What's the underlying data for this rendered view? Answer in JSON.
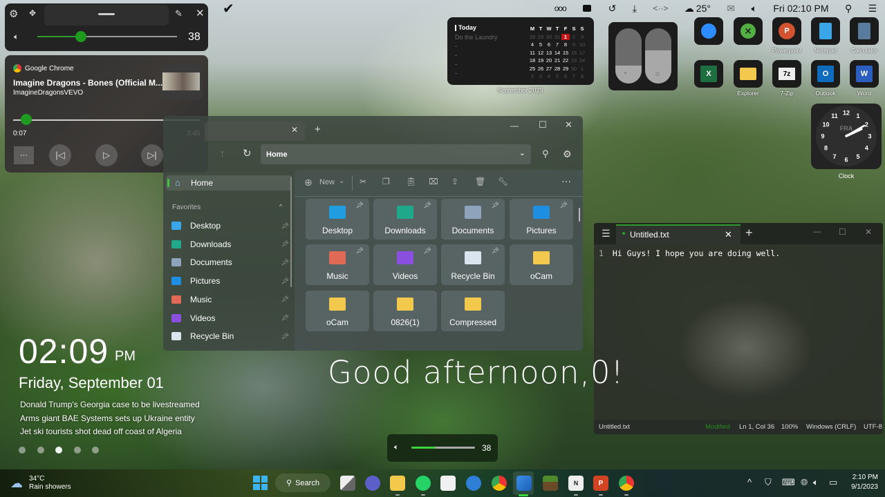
{
  "menubar": {
    "items": [
      "ooo",
      "drive-icon",
      "history-icon",
      "download-icon",
      "code-icon"
    ],
    "weather": "25°",
    "datetime": "Fri 02:10 PM"
  },
  "volume_flyout": {
    "value": "38",
    "level_percent": 38
  },
  "media": {
    "source": "Google Chrome",
    "title": "Imagine Dragons - Bones (Official M...",
    "artist": "ImagineDragonsVEVO",
    "elapsed": "0:07",
    "duration": "2:45",
    "progress_fraction": 0.042,
    "more_label": "···"
  },
  "calendar": {
    "heading": "Today",
    "task": "Do the Laundry",
    "placeholders": [
      "-",
      "-",
      "-",
      "-"
    ],
    "weekdays": [
      "M",
      "T",
      "W",
      "T",
      "F",
      "S",
      "S"
    ],
    "days": [
      [
        "28",
        "29",
        "30",
        "31",
        "1",
        "2",
        "3"
      ],
      [
        "4",
        "5",
        "6",
        "7",
        "8",
        "9",
        "10"
      ],
      [
        "11",
        "12",
        "13",
        "14",
        "15",
        "16",
        "17"
      ],
      [
        "18",
        "19",
        "20",
        "21",
        "22",
        "23",
        "24"
      ],
      [
        "25",
        "26",
        "27",
        "28",
        "29",
        "30",
        "1"
      ],
      [
        "2",
        "3",
        "4",
        "5",
        "6",
        "7",
        "8"
      ]
    ],
    "today": "1",
    "caption": "September 2023"
  },
  "sliders_widget": {
    "volume_fraction": 0.33,
    "brightness_fraction": 0.6
  },
  "apps": [
    {
      "name": "Zoom",
      "label": ""
    },
    {
      "name": "Xbox",
      "label": ""
    },
    {
      "name": "PowerPoint",
      "label": "Powerpoint"
    },
    {
      "name": "Notepad",
      "label": "Notepad"
    },
    {
      "name": "Calculator",
      "label": "Calculator"
    },
    {
      "name": "Excel",
      "label": ""
    },
    {
      "name": "Explorer",
      "label": "Explorer"
    },
    {
      "name": "7-Zip",
      "label": "7-Zip"
    },
    {
      "name": "Outlook",
      "label": "Outlook"
    },
    {
      "name": "Word",
      "label": "Word"
    }
  ],
  "clock": {
    "label": "Clock",
    "city": "FRA",
    "numbers": [
      "12",
      "1",
      "2",
      "3",
      "4",
      "5",
      "6",
      "7",
      "8",
      "9",
      "10",
      "11"
    ],
    "hour": 2,
    "minute": 10
  },
  "explorer": {
    "address": "Home",
    "toolbar": {
      "new_label": "New",
      "more": "···"
    },
    "sidebar": {
      "home": "Home",
      "section": "Favorites",
      "items": [
        "Desktop",
        "Downloads",
        "Documents",
        "Pictures",
        "Music",
        "Videos",
        "Recycle Bin"
      ]
    },
    "tiles": [
      {
        "label": "Desktop",
        "pinned": true,
        "color": "#1f9de0"
      },
      {
        "label": "Downloads",
        "pinned": true,
        "color": "#1fa88a"
      },
      {
        "label": "Documents",
        "pinned": true,
        "color": "#8fa3bd"
      },
      {
        "label": "Pictures",
        "pinned": true,
        "color": "#1e8fe0"
      },
      {
        "label": "Music",
        "pinned": true,
        "color": "#e06a55"
      },
      {
        "label": "Videos",
        "pinned": true,
        "color": "#8b4fe0"
      },
      {
        "label": "Recycle Bin",
        "pinned": true,
        "color": "#d9e4ee"
      },
      {
        "label": "oCam",
        "pinned": false,
        "color": "#f2c94c"
      },
      {
        "label": "oCam",
        "pinned": false,
        "color": "#f2c94c"
      },
      {
        "label": "0826(1)",
        "pinned": false,
        "color": "#f2c94c"
      },
      {
        "label": "Compressed",
        "pinned": false,
        "color": "#f2c94c"
      }
    ]
  },
  "notepad": {
    "tab_title": "Untitled.txt",
    "line_number": "1",
    "content": "Hi Guys! I hope you are doing well.",
    "status": {
      "file": "Untitled.txt",
      "state": "Modified",
      "position": "Ln 1, Col 36",
      "zoom": "100%",
      "line_ending": "Windows (CRLF)",
      "encoding": "UTF-8"
    }
  },
  "desktop_clock": {
    "time": "02:09",
    "ampm": "PM",
    "date": "Friday, September 01",
    "news": [
      "Donald Trump's Georgia case to be livestreamed",
      "Arms giant BAE Systems sets up Ukraine entity",
      "Jet ski tourists shot dead off coast of Algeria"
    ],
    "pages": 5,
    "active_page": 3
  },
  "greeting": "Good afternoon,0!",
  "volume_osd": {
    "value": "38",
    "level_percent": 38
  },
  "taskbar": {
    "weather_temp": "34°C",
    "weather_desc": "Rain showers",
    "search_label": "Search",
    "tray_time": "2:10 PM",
    "tray_date": "9/1/2023"
  },
  "colors": {
    "accent": "#1e9b1e",
    "today": "#c41818"
  }
}
